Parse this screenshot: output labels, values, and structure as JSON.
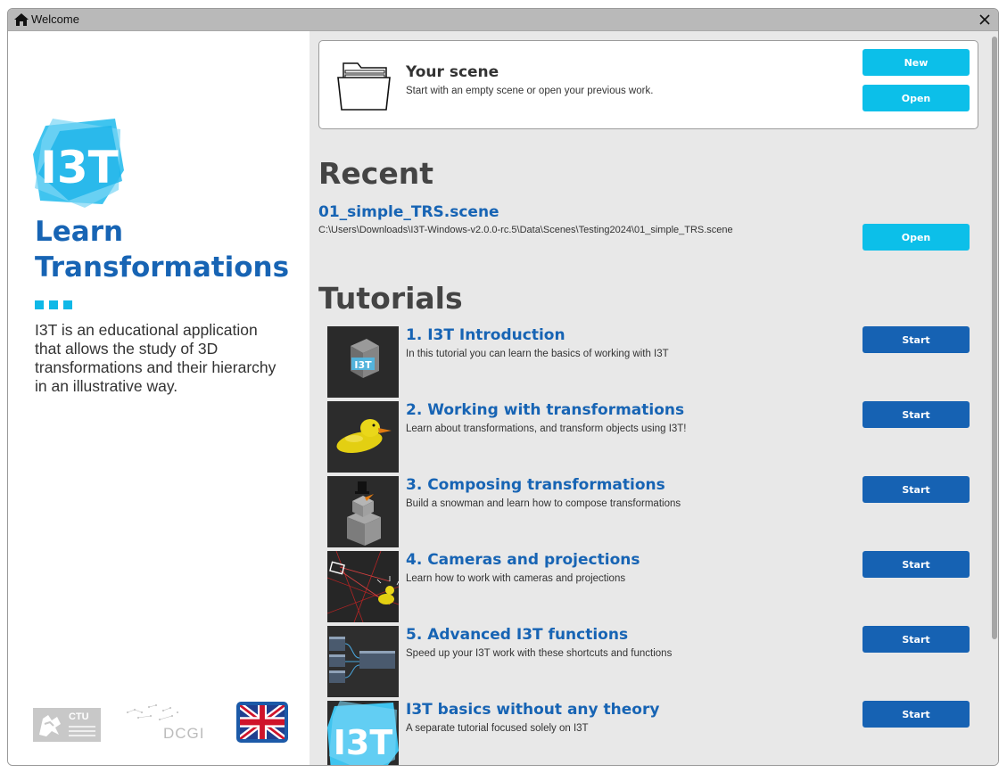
{
  "window": {
    "title": "Welcome"
  },
  "sidebar": {
    "logo_text": "I3T",
    "title": "Learn Transformations",
    "description": "I3T is an educational application that allows the study of 3D transformations and their hierarchy in an illustrative way.",
    "ctu_logo_text": "CTU",
    "dcgi_logo_text": "DCGI",
    "language_flag": "united-kingdom-flag-icon"
  },
  "scene": {
    "title": "Your scene",
    "subtitle": "Start with an empty scene or open your previous work.",
    "new_label": "New",
    "open_label": "Open"
  },
  "recent": {
    "heading": "Recent",
    "items": [
      {
        "name": "01_simple_TRS.scene",
        "path": "C:\\Users\\Downloads\\I3T-Windows-v2.0.0-rc.5\\Data\\Scenes\\Testing2024\\01_simple_TRS.scene",
        "open_label": "Open"
      }
    ]
  },
  "tutorials": {
    "heading": "Tutorials",
    "items": [
      {
        "title": "1. I3T Introduction",
        "description": "In this tutorial you can learn the basics of working with I3T",
        "button": "Start",
        "thumb_text": "I3T"
      },
      {
        "title": "2. Working with transformations",
        "description": "Learn about transformations, and transform objects using I3T!",
        "button": "Start"
      },
      {
        "title": "3. Composing transformations",
        "description": "Build a snowman and learn how to compose transformations",
        "button": "Start"
      },
      {
        "title": "4. Cameras and projections",
        "description": "Learn how to work with cameras and projections",
        "button": "Start"
      },
      {
        "title": "5. Advanced I3T functions",
        "description": "Speed up your I3T work with these shortcuts and functions",
        "button": "Start"
      },
      {
        "title": "I3T basics without any theory",
        "description": "A separate tutorial focused solely on I3T",
        "button": "Start",
        "thumb_text": "I3T"
      }
    ]
  },
  "colors": {
    "brand_blue": "#1764b4",
    "cyan_button": "#0cbfe9",
    "blue_button": "#1662b3"
  }
}
